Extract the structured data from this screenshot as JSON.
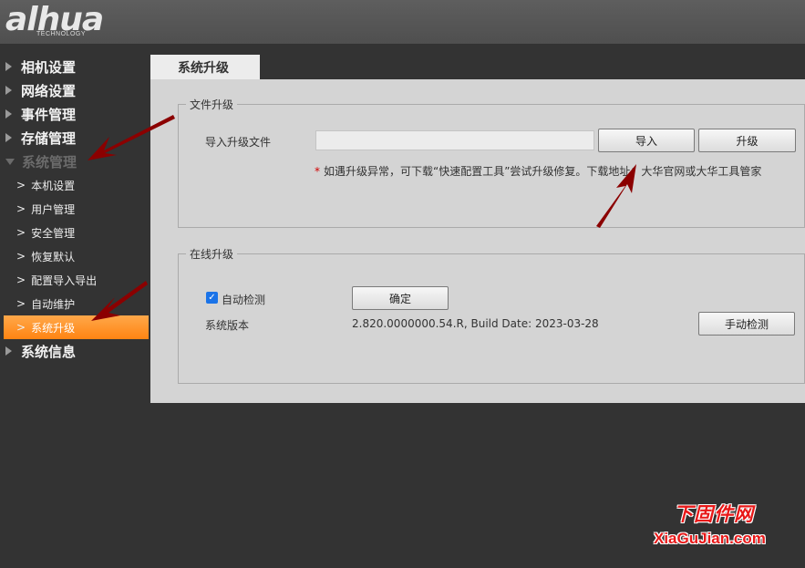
{
  "brand": {
    "logo_text": "alhua",
    "logo_sub": "TECHNOLOGY"
  },
  "sidebar": {
    "top_items": [
      {
        "label": "相机设置"
      },
      {
        "label": "网络设置"
      },
      {
        "label": "事件管理"
      },
      {
        "label": "存储管理"
      },
      {
        "label": "系统管理"
      }
    ],
    "sub_items": [
      {
        "label": "本机设置"
      },
      {
        "label": "用户管理"
      },
      {
        "label": "安全管理"
      },
      {
        "label": "恢复默认"
      },
      {
        "label": "配置导入导出"
      },
      {
        "label": "自动维护"
      },
      {
        "label": "系统升级"
      }
    ],
    "last_item": {
      "label": "系统信息"
    }
  },
  "main": {
    "tab_label": "系统升级",
    "file_upgrade": {
      "legend": "文件升级",
      "import_label": "导入升级文件",
      "file_value": "",
      "import_button": "导入",
      "upgrade_button": "升级",
      "hint_star": "*",
      "hint_text": "如遇升级异常，可下载“快速配置工具”尝试升级修复。下载地址：大华官网或大华工具管家"
    },
    "online_upgrade": {
      "legend": "在线升级",
      "auto_check_label": "自动检测",
      "auto_check_checked": true,
      "confirm_button": "确定",
      "version_label": "系统版本",
      "version_value": "2.820.0000000.54.R, Build Date: 2023-03-28",
      "manual_check_button": "手动检测"
    }
  },
  "watermark": {
    "top": "下固件网",
    "bottom": "XiaGuJian.com"
  },
  "colors": {
    "accent_active": "#ff8c1a",
    "arrow": "#8b0000",
    "watermark": "#e81818"
  }
}
